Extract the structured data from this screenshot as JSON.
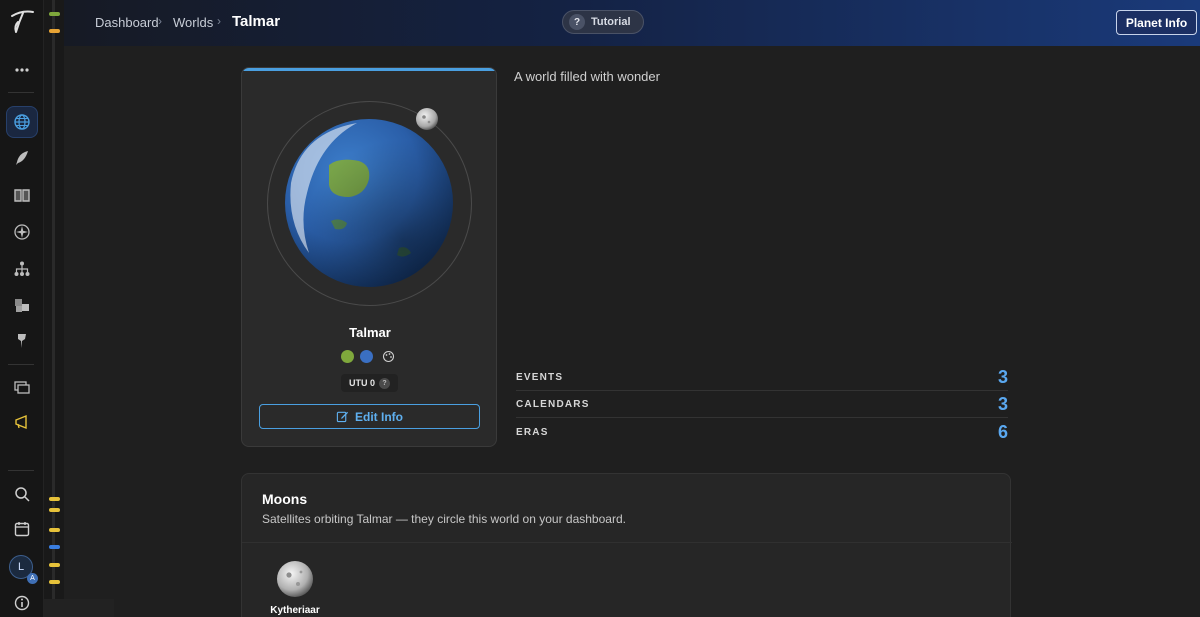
{
  "breadcrumb": {
    "items": [
      "Dashboard",
      "Worlds"
    ],
    "current": "Talmar"
  },
  "header": {
    "tutorial_label": "Tutorial",
    "tutorial_icon": "?",
    "planet_info_label": "Planet Info"
  },
  "sidebar": {
    "items": [
      {
        "name": "more-icon"
      },
      {
        "name": "globe-icon",
        "active": true
      },
      {
        "name": "quill-icon"
      },
      {
        "name": "book-icon"
      },
      {
        "name": "compass-icon"
      },
      {
        "name": "hierarchy-icon"
      },
      {
        "name": "cubes-icon"
      },
      {
        "name": "pin-icon"
      },
      {
        "name": "monitors-icon"
      },
      {
        "name": "megaphone-icon"
      },
      {
        "name": "search-icon"
      },
      {
        "name": "calendar-icon"
      },
      {
        "name": "info-icon"
      }
    ],
    "avatar_initial": "L",
    "avatar_badge": "A"
  },
  "planet": {
    "name": "Talmar",
    "colors": [
      "#7fa83c",
      "#3a6fc2"
    ],
    "utu_label": "UTU 0",
    "utu_help": "?",
    "edit_label": "Edit Info"
  },
  "description": "A world filled with wonder",
  "stats": [
    {
      "label": "EVENTS",
      "value": "3"
    },
    {
      "label": "CALENDARS",
      "value": "3"
    },
    {
      "label": "ERAS",
      "value": "6"
    }
  ],
  "moons": {
    "title": "Moons",
    "subtitle": "Satellites orbiting Talmar — they circle this world on your dashboard.",
    "items": [
      {
        "name": "Kytheriaar"
      }
    ]
  },
  "timeline_tick_colors": {
    "green": "#7fa83c",
    "orange": "#e8a435",
    "yellow": "#e6c23a",
    "blue": "#3a7ee0"
  }
}
